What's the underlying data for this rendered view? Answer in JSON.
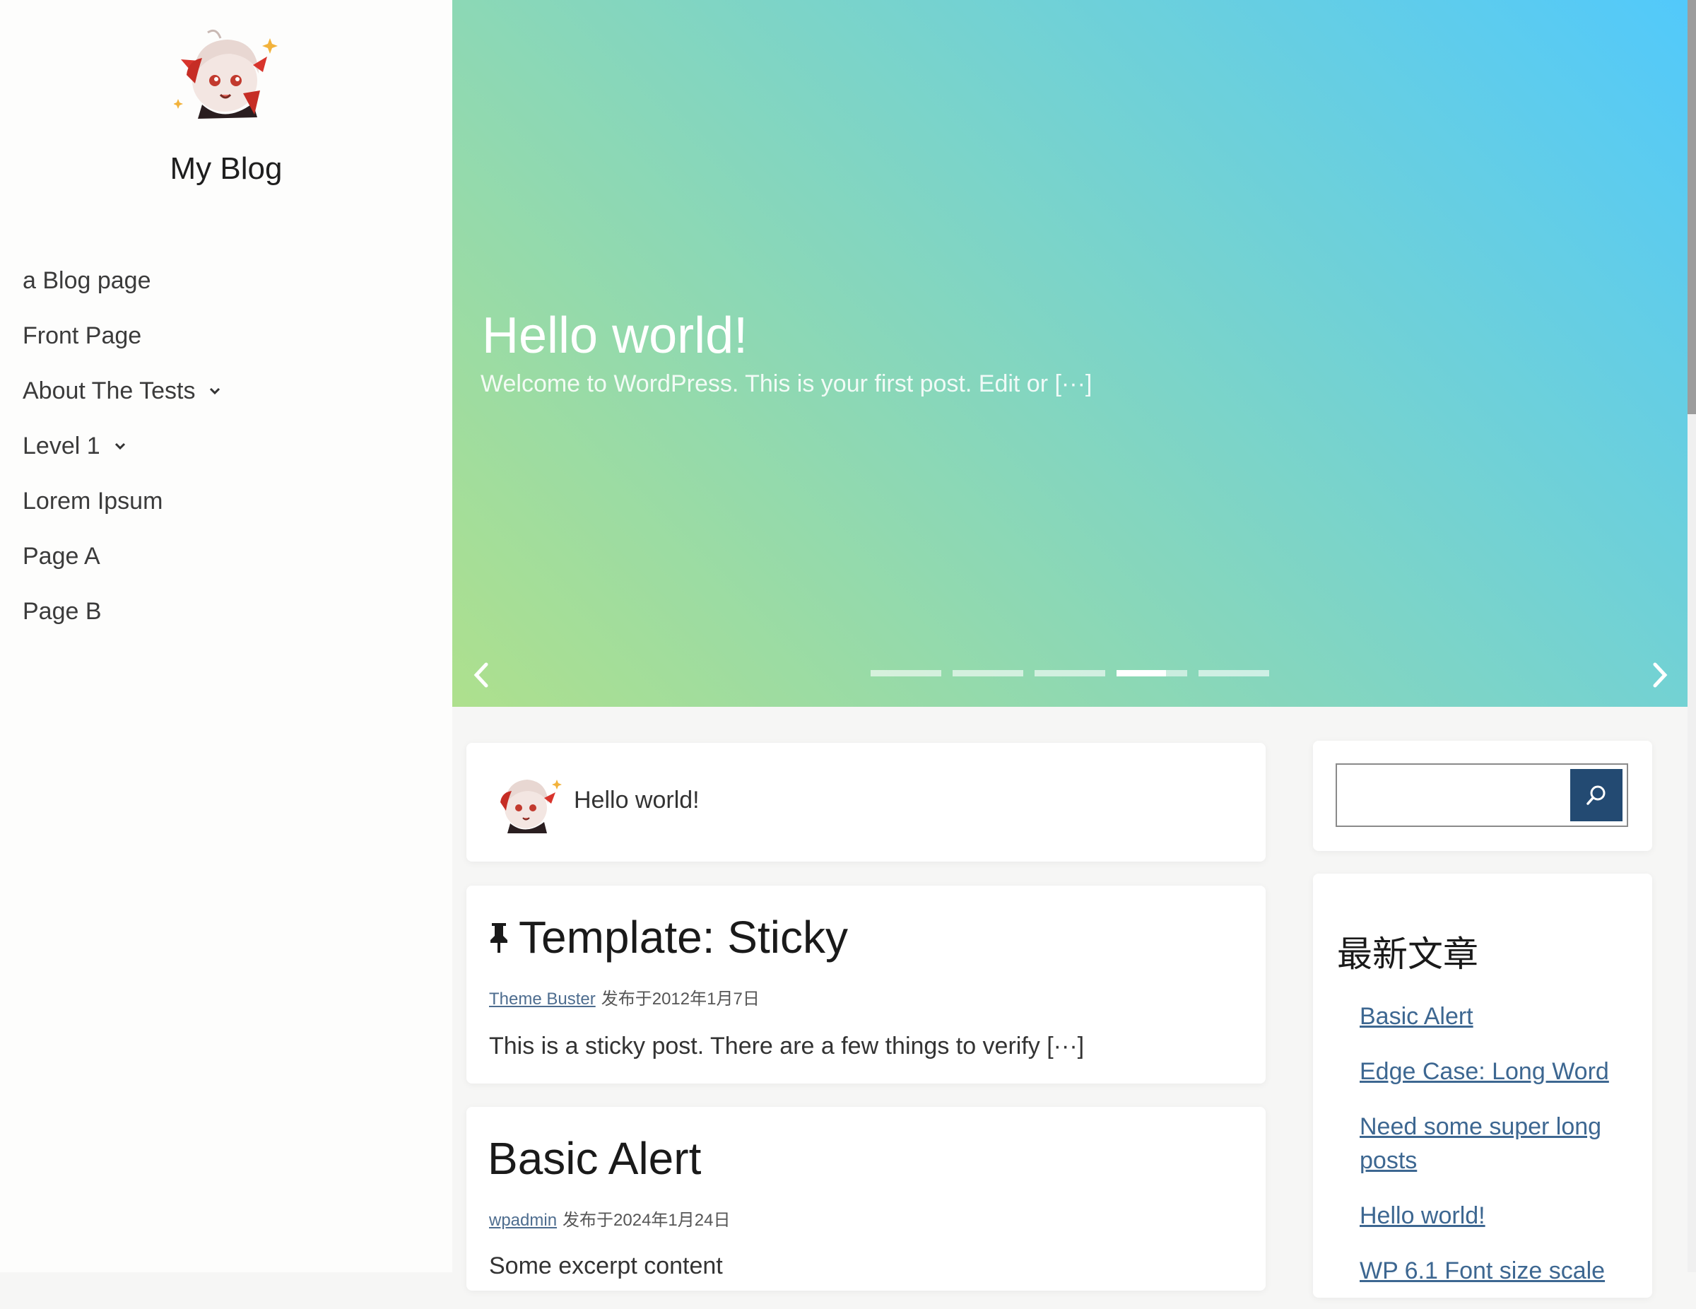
{
  "site": {
    "title": "My Blog"
  },
  "nav": {
    "items": [
      {
        "label": "a Blog page",
        "has_children": false
      },
      {
        "label": "Front Page",
        "has_children": false
      },
      {
        "label": "About The Tests",
        "has_children": true
      },
      {
        "label": "Level 1",
        "has_children": true
      },
      {
        "label": "Lorem Ipsum",
        "has_children": false
      },
      {
        "label": "Page A",
        "has_children": false
      },
      {
        "label": "Page B",
        "has_children": false
      }
    ]
  },
  "hero": {
    "title": "Hello world!",
    "excerpt": "Welcome to WordPress. This is your first post. Edit or [···]",
    "slide_count": 5,
    "active_slide": 4,
    "gradient": [
      "#52c9fb",
      "#78d3cd",
      "#aee08d"
    ]
  },
  "author_card": {
    "text": "Hello world!"
  },
  "posts": [
    {
      "title": "Template: Sticky",
      "sticky": true,
      "author": "Theme Buster",
      "date": "发布于2012年1月7日",
      "excerpt": "This is a sticky post. There are a few things to verify [···]"
    },
    {
      "title": "Basic Alert",
      "sticky": false,
      "author": "wpadmin",
      "date": "发布于2024年1月24日",
      "excerpt": "Some excerpt content"
    }
  ],
  "search": {
    "value": "",
    "placeholder": "",
    "button_icon": "search-icon"
  },
  "recent_posts": {
    "title": "最新文章",
    "items": [
      "Basic Alert",
      "Edge Case: Long Word",
      "Need some super long posts",
      "Hello world!",
      "WP 6.1 Font size scale"
    ]
  },
  "colors": {
    "accent": "#234a72",
    "link": "#3d6791"
  }
}
